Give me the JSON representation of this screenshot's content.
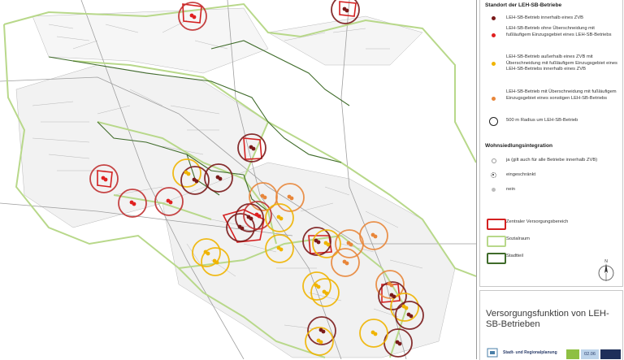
{
  "legend": {
    "section1_title": "Standort der LEH-SB-Betriebe",
    "items": [
      {
        "label": "LEH-SB-Betrieb innerhalb eines ZVB",
        "color": "#7a1a1a"
      },
      {
        "label": "LEH-SB-Betrieb ohne Überschneidung mit fußläufigem Einzugsgebiet eines LEH-SB-Betriebs",
        "color": "#e02020"
      },
      {
        "label": "LEH-SB-Betrieb außerhalb eines ZVB mit Überschneidung mit fußläufigem Einzugsgebiet eines LEH-SB-Betriebs innerhalb eines ZVB",
        "color": "#f0b400"
      },
      {
        "label": "LEH-SB-Betrieb mit Überschneidung mit fußläufigem Einzugsgebiet eines sonstigen LEH-SB-Betriebs",
        "color": "#e8863a"
      },
      {
        "label": "500 m Radius um LEH-SB-Betrieb",
        "color": "#222222"
      }
    ],
    "section2_title": "Wohnsiedlungsintegration",
    "integration": [
      {
        "label": "ja (gilt auch für alle Betriebe innerhalb ZVB)"
      },
      {
        "label": "eingeschränkt"
      },
      {
        "label": "nein"
      }
    ],
    "areas": [
      {
        "label": "Zentraler Versorgungsbereich",
        "color": "#d42020"
      },
      {
        "label": "Sozialraum",
        "color": "#b8d88a"
      },
      {
        "label": "Stadtteil",
        "color": "#3f6b2a"
      }
    ]
  },
  "title_box": {
    "title": "Versorgungsfunktion von LEH-SB-Betrieben",
    "footer_label": "Stadt- und Regionalplanung",
    "code": "02.06"
  }
}
